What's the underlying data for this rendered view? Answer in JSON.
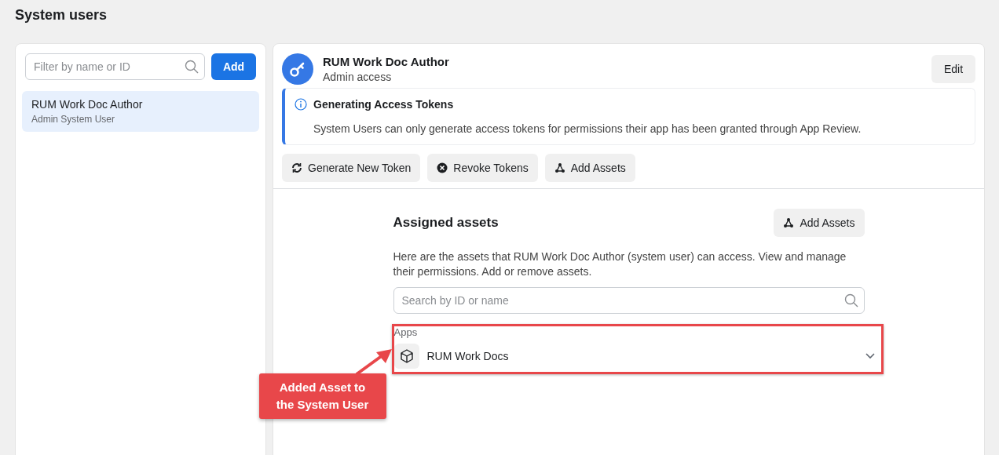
{
  "page_title": "System users",
  "sidebar": {
    "filter": {
      "placeholder": "Filter by name or ID"
    },
    "add_button": "Add",
    "items": [
      {
        "name": "RUM Work Doc Author",
        "subtitle": "Admin System User",
        "selected": true
      }
    ]
  },
  "user": {
    "name": "RUM Work Doc Author",
    "role": "Admin access",
    "edit_button": "Edit"
  },
  "notice": {
    "title": "Generating Access Tokens",
    "text": "System Users can only generate access tokens for permissions their app has been granted through App Review."
  },
  "actions": [
    {
      "kind": "refresh",
      "label": "Generate New Token"
    },
    {
      "kind": "revoke",
      "label": "Revoke Tokens"
    },
    {
      "kind": "assets",
      "label": "Add Assets"
    }
  ],
  "assigned": {
    "title": "Assigned assets",
    "add_button": "Add Assets",
    "description": "Here are the assets that RUM Work Doc Author (system user) can access. View and manage their permissions. Add or remove assets.",
    "search": {
      "placeholder": "Search by ID or name"
    },
    "groups": [
      {
        "label": "Apps",
        "items": [
          {
            "name": "RUM Work Docs",
            "expanded": false
          }
        ]
      }
    ]
  },
  "annotation": {
    "text": "Added Asset to the System User"
  }
}
